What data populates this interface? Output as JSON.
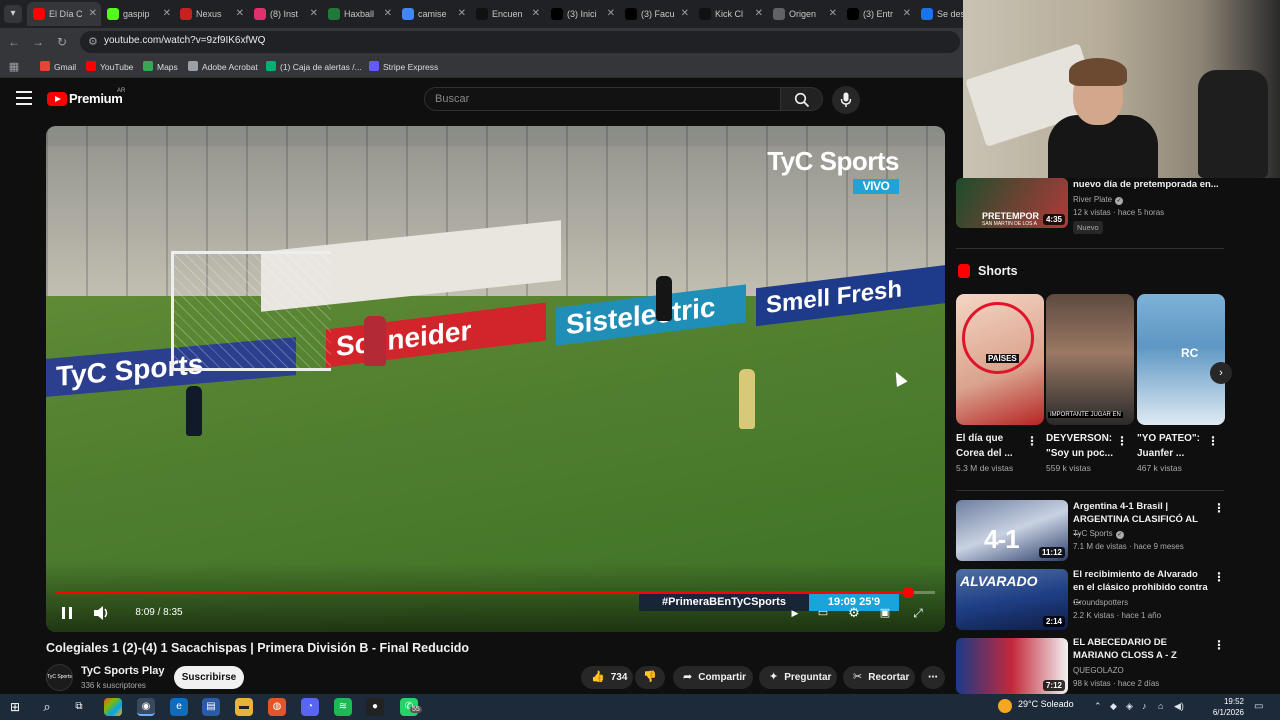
{
  "browser": {
    "tabs": [
      {
        "label": "El Día C",
        "icon": "youtube-icon",
        "color": "#ff0000"
      },
      {
        "label": "gaspip",
        "icon": "kick-icon",
        "color": "#53fc18"
      },
      {
        "label": "Nexus",
        "icon": "mail-icon",
        "color": "#c5221f"
      },
      {
        "label": "(8) Inst",
        "icon": "instagram-icon",
        "color": "#e1306c"
      },
      {
        "label": "Haxball",
        "icon": "haxball-icon",
        "color": "#1f7a3a"
      },
      {
        "label": "camise",
        "icon": "google-icon",
        "color": "#4285f4"
      },
      {
        "label": "Encuen",
        "icon": "tiktok-icon",
        "color": "#111111"
      },
      {
        "label": "(3) Inici",
        "icon": "x-icon",
        "color": "#000000"
      },
      {
        "label": "(3) Facu",
        "icon": "x-icon",
        "color": "#000000"
      },
      {
        "label": "Kick Cl",
        "icon": "tiktok-icon",
        "color": "#111111"
      },
      {
        "label": "Origen",
        "icon": "globe-icon",
        "color": "#5f6368"
      },
      {
        "label": "(3) Entr",
        "icon": "x-icon",
        "color": "#000000"
      },
      {
        "label": "Se desc",
        "icon": "edge-icon",
        "color": "#1a73e8"
      }
    ],
    "url": "youtube.com/watch?v=9zf9IK6xfWQ",
    "bookmarks": [
      {
        "label": "Gmail",
        "color": "#ea4335"
      },
      {
        "label": "YouTube",
        "color": "#ff0000"
      },
      {
        "label": "Maps",
        "color": "#34a853"
      },
      {
        "label": "Adobe Acrobat",
        "color": "#9aa0a6"
      },
      {
        "label": "(1) Caja de alertas /...",
        "color": "#00b171"
      },
      {
        "label": "Stripe Express",
        "color": "#635bff"
      }
    ]
  },
  "youtube": {
    "logo_text": "Premium",
    "country_code": "AR",
    "search_placeholder": "Buscar"
  },
  "player": {
    "watermark_brand": "TyC Sports",
    "watermark_live": "VIVO",
    "hashtag": "#PrimeraBEnTyCSports",
    "scorebug": "19:09  25'9",
    "boards": [
      "TyC Sports",
      "Schneider",
      "Sistelectric",
      "Smell Fresh"
    ],
    "time_text": "8:09 / 8:35",
    "progress_fraction": 0.969
  },
  "video": {
    "title": "Colegiales 1 (2)-(4) 1 Sacachispas | Primera División B - Final Reducido",
    "channel_name": "TyC Sports Play",
    "channel_avatar_text": "TyC Sports",
    "subscribers": "336 k suscriptores",
    "subscribe_label": "Suscribirse",
    "likes": "734",
    "share_label": "Compartir",
    "ask_label": "Preguntar",
    "clip_label": "Recortar"
  },
  "sidebar": {
    "top_video": {
      "title": "nuevo día de pretemporada en...",
      "channel": "River Plate",
      "meta": "12 k vistas · hace 5 horas",
      "badge": "Nuevo",
      "duration": "4:35",
      "thumb_text": "PRETEMPOR",
      "thumb_subtext": "SAN MARTIN DE LOS A"
    },
    "shorts_heading": "Shorts",
    "shorts": [
      {
        "title": "El día que Corea del ...",
        "views": "5.3 M de vistas",
        "overlay": "PAÍSES"
      },
      {
        "title": "DEYVERSON: \"Soy un poc...",
        "views": "559 k vistas",
        "overlay": "IMPORTANTE JUGAR EN"
      },
      {
        "title": "\"YO PATEO\": Juanfer ...",
        "views": "467 k vistas",
        "overlay": "RC"
      }
    ],
    "videos": [
      {
        "title": "Argentina 4-1 Brasil | ARGENTINA CLASIFICÓ AL ...",
        "channel": "TyC Sports",
        "verified": true,
        "meta": "7.1 M de vistas · hace 9 meses",
        "duration": "11:12",
        "thumb_text": "4-1"
      },
      {
        "title": "El recibimiento de Alvarado en el clásico prohibido contra ...",
        "channel": "Groundspotters",
        "verified": false,
        "meta": "2.2 K vistas · hace 1 año",
        "duration": "2:14",
        "thumb_text": "ALVARADO"
      },
      {
        "title": "EL ABECEDARIO DE MARIANO CLOSS A - Z",
        "channel": "QUEGOLAZO",
        "verified": false,
        "meta": "98 k vistas · hace 2 días",
        "duration": "7:12",
        "thumb_text": ""
      }
    ]
  },
  "taskbar": {
    "weather": "29°C  Soleado",
    "time": "19:52",
    "date": "6/1/2026",
    "whatsapp_badge": "55"
  }
}
